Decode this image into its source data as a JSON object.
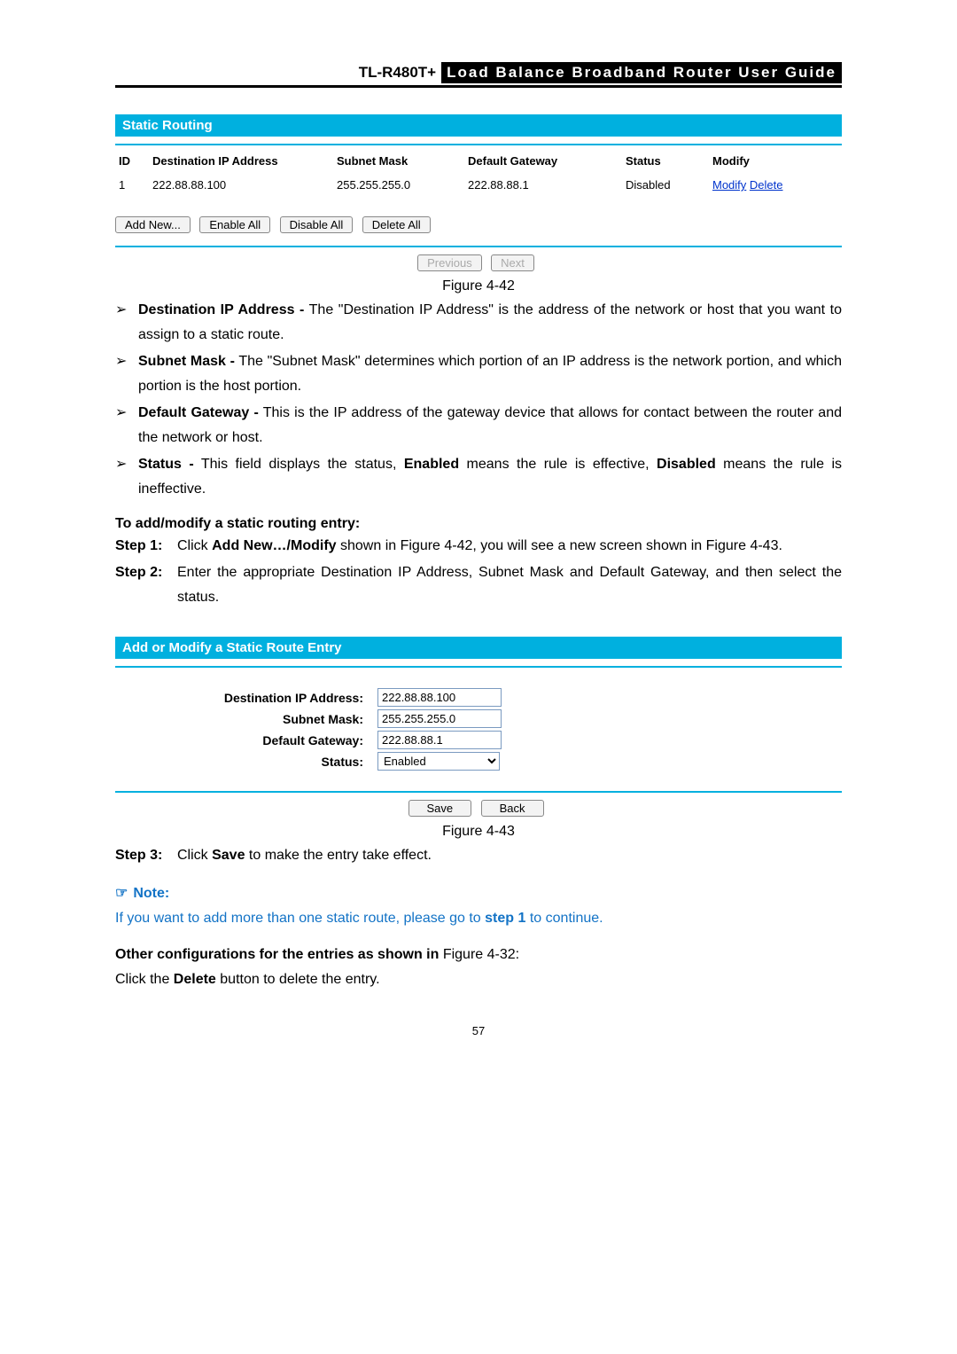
{
  "header": {
    "model": "TL-R480T+",
    "title": "Load  Balance  Broadband  Router  User  Guide"
  },
  "panel1": {
    "title": "Static Routing",
    "cols": [
      "ID",
      "Destination IP Address",
      "Subnet Mask",
      "Default Gateway",
      "Status",
      "Modify"
    ],
    "rows": [
      {
        "id": "1",
        "dest": "222.88.88.100",
        "mask": "255.255.255.0",
        "gw": "222.88.88.1",
        "status": "Disabled",
        "mod": "Modify",
        "del": "Delete"
      }
    ],
    "buttons": {
      "add": "Add New...",
      "enable": "Enable All",
      "disable": "Disable All",
      "delete": "Delete All"
    },
    "pager": {
      "prev": "Previous",
      "next": "Next"
    },
    "caption": "Figure 4-42"
  },
  "bullets": [
    {
      "term": "Destination IP Address -",
      "text": " The \"Destination IP Address\" is the address of the network or host that you want to assign to a static route."
    },
    {
      "term": "Subnet Mask -",
      "text": " The \"Subnet Mask\" determines which portion of an IP address is the network portion, and which portion is the host portion."
    },
    {
      "term": "Default Gateway -",
      "text": " This is the IP address of the gateway device that allows for contact between the router and the network or host."
    },
    {
      "term": "Status -",
      "text1": " This field displays the status, ",
      "bold1": "Enabled",
      "text2": " means the rule is effective, ",
      "bold2": "Disabled",
      "text3": " means the rule is ineffective."
    }
  ],
  "addmod": {
    "heading": "To add/modify a static routing entry:",
    "steps": [
      {
        "label": "Step 1:",
        "pre": "Click ",
        "bold": "Add New…/Modify",
        "post": " shown in Figure 4-42, you will see a new screen shown in Figure 4-43."
      },
      {
        "label": "Step 2:",
        "text": "Enter the appropriate Destination IP Address, Subnet Mask and Default Gateway, and then select the status."
      }
    ]
  },
  "panel2": {
    "title": "Add or Modify a Static Route Entry",
    "fields": {
      "dest_label": "Destination IP Address:",
      "dest_val": "222.88.88.100",
      "mask_label": "Subnet Mask:",
      "mask_val": "255.255.255.0",
      "gw_label": "Default Gateway:",
      "gw_val": "222.88.88.1",
      "status_label": "Status:",
      "status_val": "Enabled"
    },
    "buttons": {
      "save": "Save",
      "back": "Back"
    },
    "caption": "Figure 4-43"
  },
  "step3": {
    "label": "Step 3:",
    "pre": "Click ",
    "bold": "Save",
    "post": " to make the entry take effect."
  },
  "note": {
    "title": "Note:",
    "body_pre": "If you want to add more than one static route, please go to ",
    "body_bold": "step 1",
    "body_post": " to continue."
  },
  "other": {
    "heading_pre": "Other configurations for the entries as shown in ",
    "heading_post": "Figure 4-32:",
    "line_pre": "Click the ",
    "line_bold": "Delete",
    "line_post": " button to delete the entry."
  },
  "page_number": "57"
}
